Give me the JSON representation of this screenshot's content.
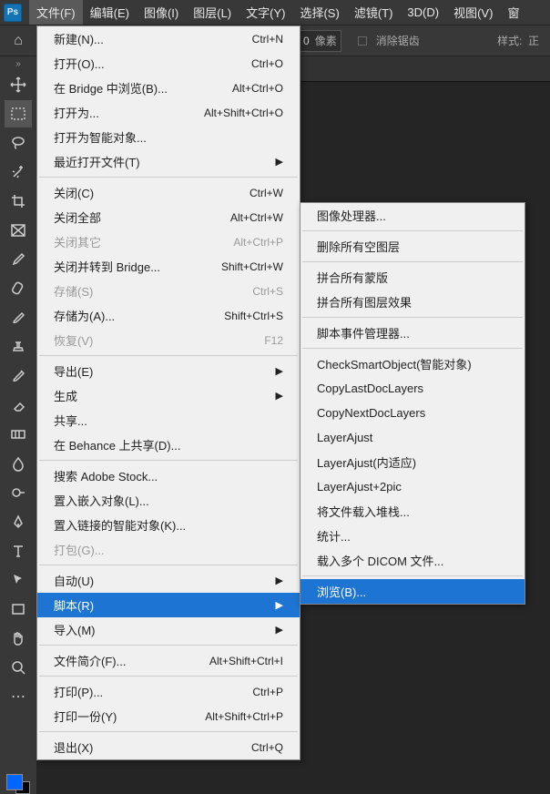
{
  "menubar": {
    "items": [
      "文件(F)",
      "编辑(E)",
      "图像(I)",
      "图层(L)",
      "文字(Y)",
      "选择(S)",
      "滤镜(T)",
      "3D(D)",
      "视图(V)",
      "窗"
    ]
  },
  "options": {
    "px_value": "0",
    "px_unit": "像素",
    "antialias": "消除锯齿",
    "style": "样式:",
    "style_val": "正"
  },
  "file_menu": [
    {
      "label": "新建(N)...",
      "shortcut": "Ctrl+N"
    },
    {
      "label": "打开(O)...",
      "shortcut": "Ctrl+O"
    },
    {
      "label": "在 Bridge 中浏览(B)...",
      "shortcut": "Alt+Ctrl+O"
    },
    {
      "label": "打开为...",
      "shortcut": "Alt+Shift+Ctrl+O"
    },
    {
      "label": "打开为智能对象..."
    },
    {
      "label": "最近打开文件(T)",
      "sub": true
    },
    {
      "sep": true
    },
    {
      "label": "关闭(C)",
      "shortcut": "Ctrl+W"
    },
    {
      "label": "关闭全部",
      "shortcut": "Alt+Ctrl+W"
    },
    {
      "label": "关闭其它",
      "shortcut": "Alt+Ctrl+P",
      "disabled": true
    },
    {
      "label": "关闭并转到 Bridge...",
      "shortcut": "Shift+Ctrl+W"
    },
    {
      "label": "存储(S)",
      "shortcut": "Ctrl+S",
      "disabled": true
    },
    {
      "label": "存储为(A)...",
      "shortcut": "Shift+Ctrl+S"
    },
    {
      "label": "恢复(V)",
      "shortcut": "F12",
      "disabled": true
    },
    {
      "sep": true
    },
    {
      "label": "导出(E)",
      "sub": true
    },
    {
      "label": "生成",
      "sub": true
    },
    {
      "label": "共享..."
    },
    {
      "label": "在 Behance 上共享(D)..."
    },
    {
      "sep": true
    },
    {
      "label": "搜索 Adobe Stock..."
    },
    {
      "label": "置入嵌入对象(L)..."
    },
    {
      "label": "置入链接的智能对象(K)..."
    },
    {
      "label": "打包(G)...",
      "disabled": true
    },
    {
      "sep": true
    },
    {
      "label": "自动(U)",
      "sub": true
    },
    {
      "label": "脚本(R)",
      "sub": true,
      "highlight": true
    },
    {
      "label": "导入(M)",
      "sub": true
    },
    {
      "sep": true
    },
    {
      "label": "文件简介(F)...",
      "shortcut": "Alt+Shift+Ctrl+I"
    },
    {
      "sep": true
    },
    {
      "label": "打印(P)...",
      "shortcut": "Ctrl+P"
    },
    {
      "label": "打印一份(Y)",
      "shortcut": "Alt+Shift+Ctrl+P"
    },
    {
      "sep": true
    },
    {
      "label": "退出(X)",
      "shortcut": "Ctrl+Q"
    }
  ],
  "scripts_submenu": [
    {
      "label": "图像处理器..."
    },
    {
      "sep": true
    },
    {
      "label": "删除所有空图层"
    },
    {
      "sep": true
    },
    {
      "label": "拼合所有蒙版"
    },
    {
      "label": "拼合所有图层效果"
    },
    {
      "sep": true
    },
    {
      "label": "脚本事件管理器..."
    },
    {
      "sep": true
    },
    {
      "label": "CheckSmartObject(智能对象)"
    },
    {
      "label": "CopyLastDocLayers"
    },
    {
      "label": "CopyNextDocLayers"
    },
    {
      "label": "LayerAjust"
    },
    {
      "label": "LayerAjust(内适应)"
    },
    {
      "label": "LayerAjust+2pic"
    },
    {
      "label": "将文件载入堆栈..."
    },
    {
      "label": "统计..."
    },
    {
      "label": "载入多个 DICOM 文件..."
    },
    {
      "sep": true
    },
    {
      "label": "浏览(B)...",
      "highlight": true
    }
  ]
}
